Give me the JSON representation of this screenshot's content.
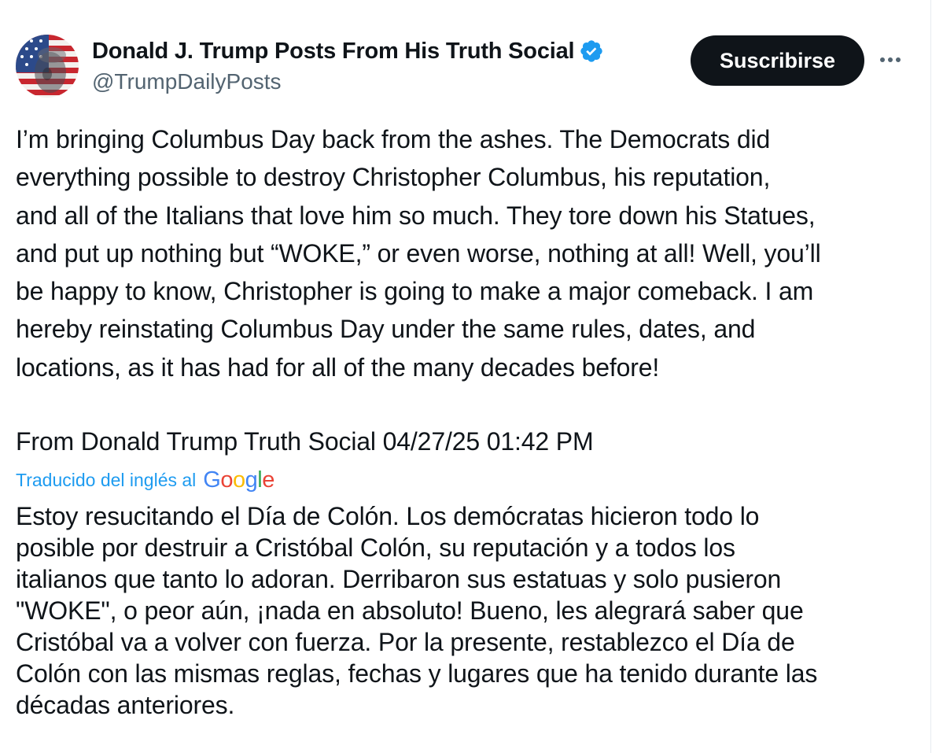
{
  "author": {
    "display_name": "Donald J. Trump Posts From His Truth Social",
    "handle": "@TrumpDailyPosts",
    "avatar_icon": "flag-portrait-avatar",
    "verified_icon": "verified-badge-icon",
    "verified_color": "#1d9bf0"
  },
  "actions": {
    "subscribe_label": "Suscribirse",
    "more_icon": "more-options-icon"
  },
  "post": {
    "text": "I’m bringing Columbus Day back from the ashes. The Democrats did\neverything possible to destroy Christopher Columbus, his reputation,\nand all of the Italians that love him so much. They tore down his Statues,\nand put up nothing but “WOKE,” or even worse, nothing at all! Well, you’ll\nbe happy to know, Christopher is going to make a major comeback. I am\nhereby reinstating Columbus Day under the same rules, dates, and\nlocations, as it has had for all of the many decades before!",
    "source_line": "From Donald Trump Truth Social 04/27/25 01:42 PM"
  },
  "translation": {
    "label": "Traducido del inglés al",
    "provider": {
      "letters": [
        "G",
        "o",
        "o",
        "g",
        "l",
        "e"
      ],
      "colors": [
        "#4285F4",
        "#EA4335",
        "#FBBC05",
        "#4285F4",
        "#34A853",
        "#EA4335"
      ]
    },
    "text": "Estoy resucitando el Día de Colón. Los demócratas hicieron todo lo\nposible por destruir a Cristóbal Colón, su reputación y a todos los\nitalianos que tanto lo adoran. Derribaron sus estatuas y solo pusieron\n\"WOKE\", o peor aún, ¡nada en absoluto! Bueno, les alegrará saber que\nCristóbal va a volver con fuerza. Por la presente, restablezco el Día de\nColón con las mismas reglas, fechas y lugares que ha tenido durante las\ndécadas anteriores."
  }
}
